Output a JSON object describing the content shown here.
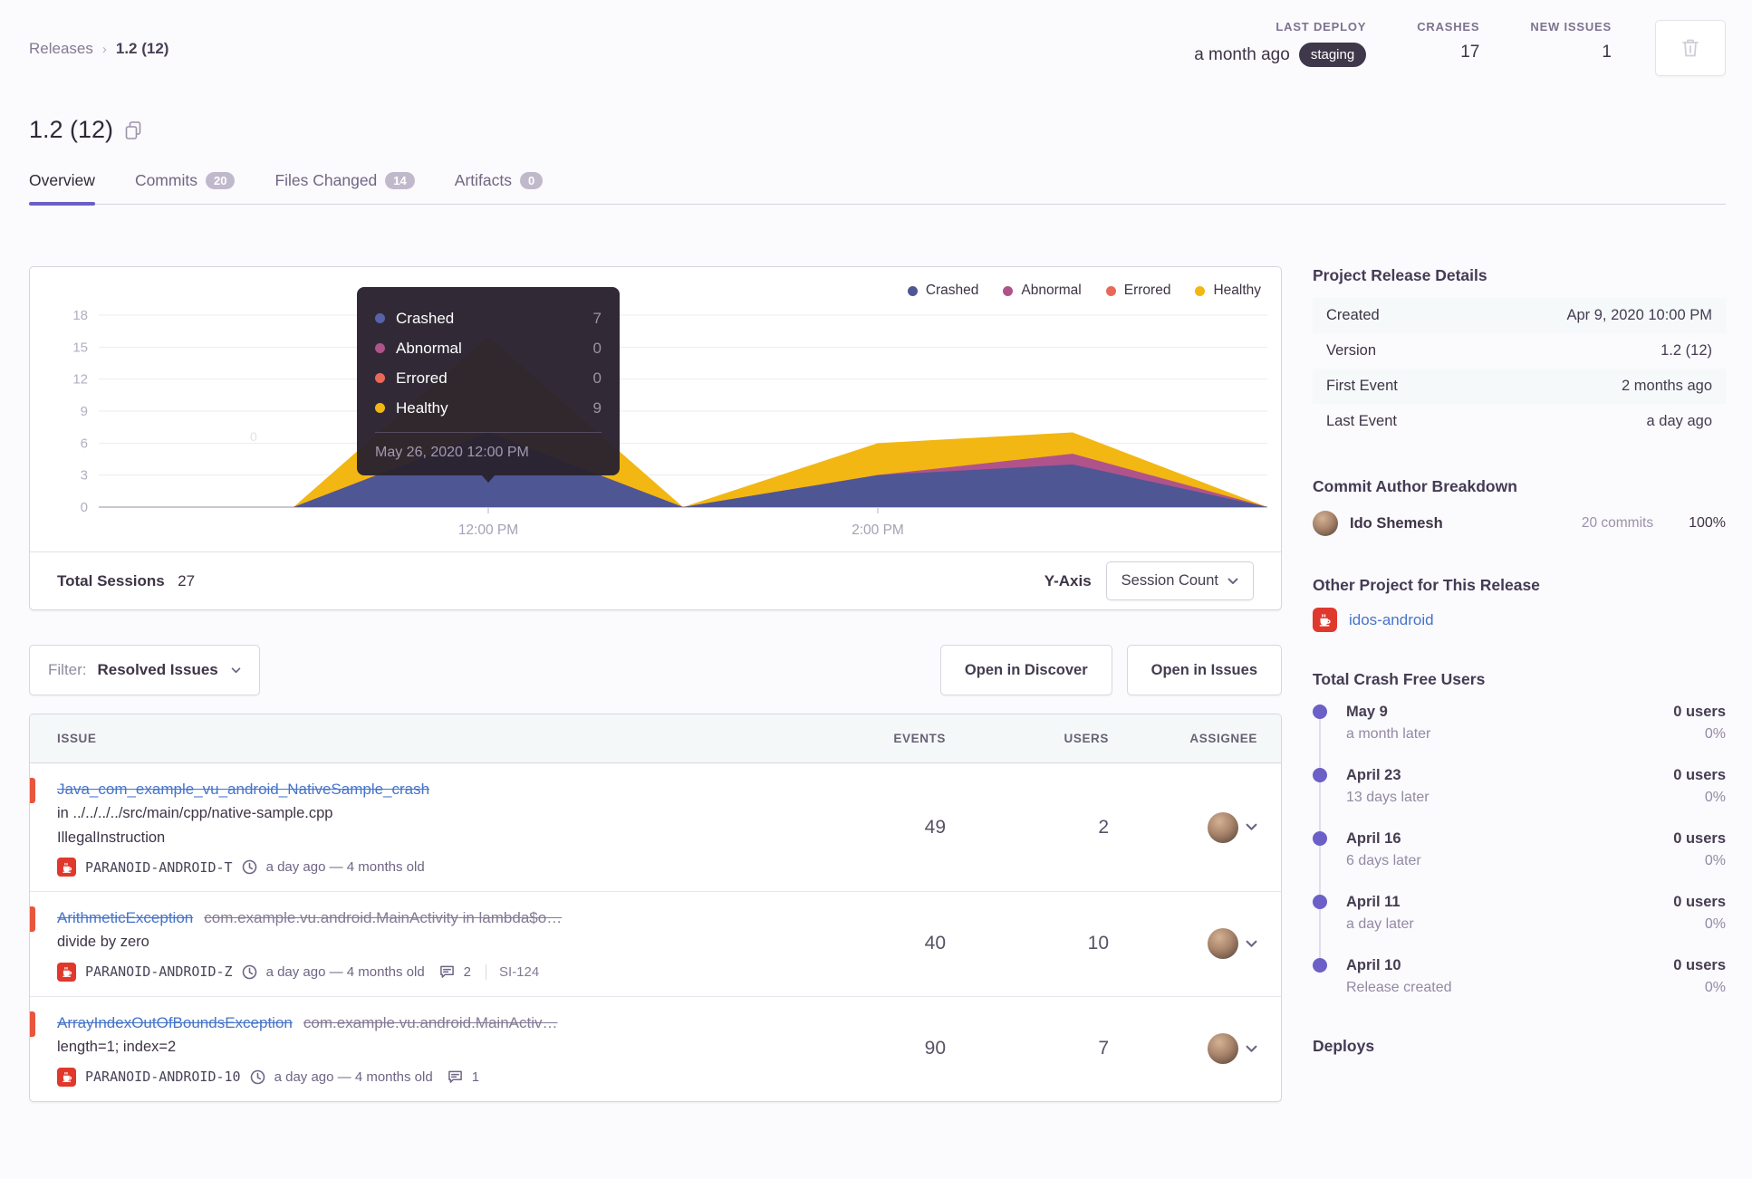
{
  "header": {
    "breadcrumb": {
      "parent": "Releases",
      "current": "1.2 (12)"
    },
    "stats": [
      {
        "label": "LAST DEPLOY",
        "value": "a month ago",
        "badge": "staging"
      },
      {
        "label": "CRASHES",
        "value": "17"
      },
      {
        "label": "NEW ISSUES",
        "value": "1"
      }
    ],
    "title": "1.2 (12)",
    "tabs": [
      {
        "label": "Overview"
      },
      {
        "label": "Commits",
        "badge": "20"
      },
      {
        "label": "Files Changed",
        "badge": "14"
      },
      {
        "label": "Artifacts",
        "badge": "0"
      }
    ]
  },
  "chart": {
    "legend": [
      {
        "label": "Crashed",
        "color": "#4F5694"
      },
      {
        "label": "Abnormal",
        "color": "#B0538B"
      },
      {
        "label": "Errored",
        "color": "#EA6857"
      },
      {
        "label": "Healthy",
        "color": "#F2B712"
      }
    ],
    "tooltip": {
      "rows": [
        {
          "label": "Crashed",
          "value": "7",
          "color": "#5763A8"
        },
        {
          "label": "Abnormal",
          "value": "0",
          "color": "#B0538B"
        },
        {
          "label": "Errored",
          "value": "0",
          "color": "#EA6857"
        },
        {
          "label": "Healthy",
          "value": "9",
          "color": "#F2B712"
        }
      ],
      "footer": "May 26, 2020 12:00 PM"
    },
    "footer": {
      "total_label": "Total Sessions",
      "total_value": "27",
      "yaxis_label": "Y-Axis",
      "yaxis_value": "Session Count"
    }
  },
  "chart_data": {
    "type": "area",
    "stacked": true,
    "x": [
      "10:00 AM",
      "11:00 AM",
      "12:00 PM",
      "1:00 PM",
      "2:00 PM",
      "3:00 PM",
      "4:00 PM"
    ],
    "series": [
      {
        "name": "Crashed",
        "color": "#4F5694",
        "values": [
          0,
          0,
          7,
          0,
          3,
          4,
          0
        ]
      },
      {
        "name": "Abnormal",
        "color": "#B0538B",
        "values": [
          0,
          0,
          0,
          0,
          0,
          1,
          0
        ]
      },
      {
        "name": "Errored",
        "color": "#EA6857",
        "values": [
          0,
          0,
          0,
          0,
          0,
          0,
          0
        ]
      },
      {
        "name": "Healthy",
        "color": "#F2B712",
        "values": [
          0,
          0,
          9,
          0,
          3,
          2,
          0
        ]
      }
    ],
    "y_ticks": [
      0,
      3,
      6,
      9,
      12,
      15,
      18
    ],
    "ylim": [
      0,
      18
    ],
    "x_ticks": [
      {
        "index": 2,
        "label": "12:00 PM"
      },
      {
        "index": 4,
        "label": "2:00 PM"
      }
    ],
    "grid": true,
    "legend_position": "top-right",
    "tooltip_point": {
      "x": "12:00 PM",
      "date_label": "May 26, 2020 12:00 PM",
      "crashed": 7,
      "abnormal": 0,
      "errored": 0,
      "healthy": 9
    },
    "stray_hover_label": "0"
  },
  "filter_bar": {
    "filter_label": "Filter:",
    "filter_value": "Resolved Issues",
    "open_discover": "Open in Discover",
    "open_issues": "Open in Issues"
  },
  "issues": {
    "columns": {
      "issue": "ISSUE",
      "events": "EVENTS",
      "users": "USERS",
      "assignee": "ASSIGNEE"
    },
    "rows": [
      {
        "title": "Java_com_example_vu_android_NativeSample_crash",
        "culprit": "",
        "line2": "in ../../../../src/main/cpp/native-sample.cpp",
        "line3": "IllegalInstruction",
        "project": "PARANOID-ANDROID-T",
        "age": "a day ago — 4 months old",
        "comments": "",
        "ref": "",
        "events": "49",
        "users": "2"
      },
      {
        "title": "ArithmeticException",
        "culprit": "com.example.vu.android.MainActivity in lambda$o…",
        "line2": "divide by zero",
        "line3": "",
        "project": "PARANOID-ANDROID-Z",
        "age": "a day ago — 4 months old",
        "comments": "2",
        "ref": "SI-124",
        "events": "40",
        "users": "10"
      },
      {
        "title": "ArrayIndexOutOfBoundsException",
        "culprit": "com.example.vu.android.MainActiv…",
        "line2": "length=1; index=2",
        "line3": "",
        "project": "PARANOID-ANDROID-10",
        "age": "a day ago — 4 months old",
        "comments": "1",
        "ref": "",
        "events": "90",
        "users": "7"
      }
    ]
  },
  "sidebar": {
    "details": {
      "heading": "Project Release Details",
      "rows": [
        {
          "label": "Created",
          "value": "Apr 9, 2020 10:00 PM"
        },
        {
          "label": "Version",
          "value": "1.2 (12)"
        },
        {
          "label": "First Event",
          "value": "2 months ago"
        },
        {
          "label": "Last Event",
          "value": "a day ago"
        }
      ]
    },
    "authors": {
      "heading": "Commit Author Breakdown",
      "name": "Ido Shemesh",
      "commits": "20 commits",
      "percent": "100%"
    },
    "other_project": {
      "heading": "Other Project for This Release",
      "link": "idos-android"
    },
    "crash_free": {
      "heading": "Total Crash Free Users",
      "items": [
        {
          "date": "May 9",
          "sub": "a month later",
          "users": "0 users",
          "pct": "0%"
        },
        {
          "date": "April 23",
          "sub": "13 days later",
          "users": "0 users",
          "pct": "0%"
        },
        {
          "date": "April 16",
          "sub": "6 days later",
          "users": "0 users",
          "pct": "0%"
        },
        {
          "date": "April 11",
          "sub": "a day later",
          "users": "0 users",
          "pct": "0%"
        },
        {
          "date": "April 10",
          "sub": "Release created",
          "users": "0 users",
          "pct": "0%"
        }
      ]
    },
    "deploys_heading": "Deploys"
  }
}
